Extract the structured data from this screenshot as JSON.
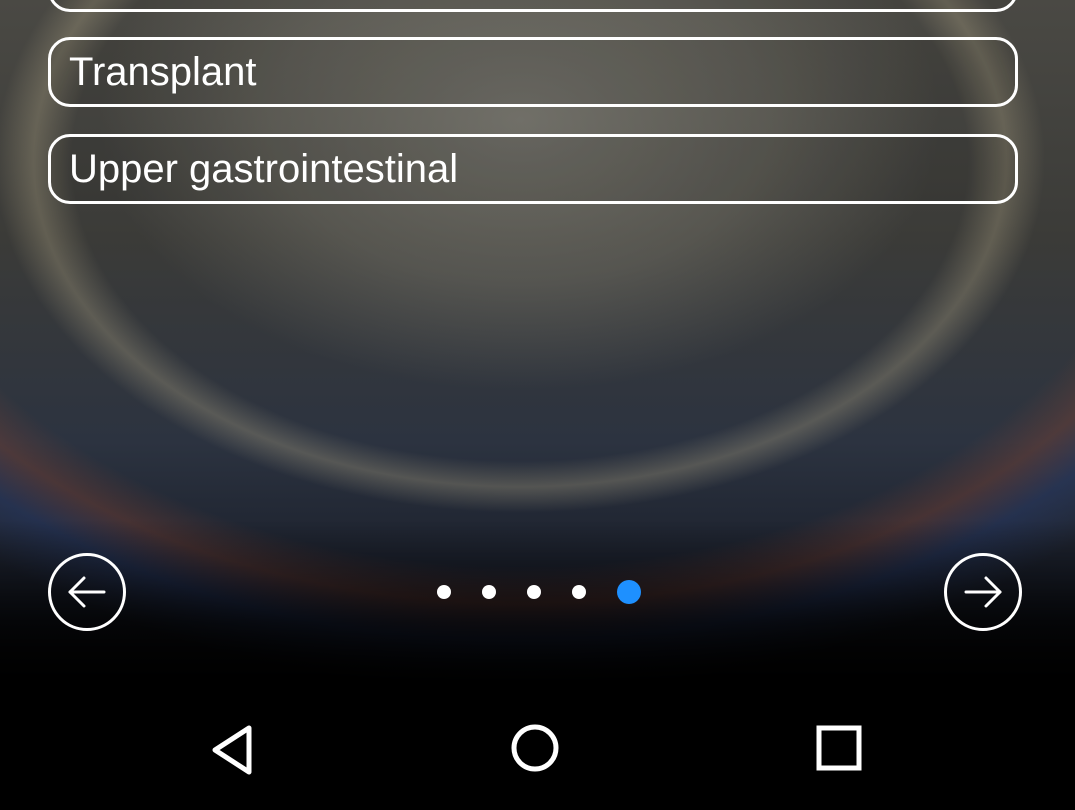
{
  "options": {
    "partial": "",
    "transplant": "Transplant",
    "upper_gi": "Upper gastrointestinal"
  },
  "pager": {
    "total": 5,
    "active_index": 4,
    "active_color": "#1e90ff"
  },
  "icons": {
    "prev": "arrow-left-icon",
    "next": "arrow-right-icon",
    "back": "back-triangle-icon",
    "home": "home-circle-icon",
    "recent": "recent-apps-square-icon"
  }
}
